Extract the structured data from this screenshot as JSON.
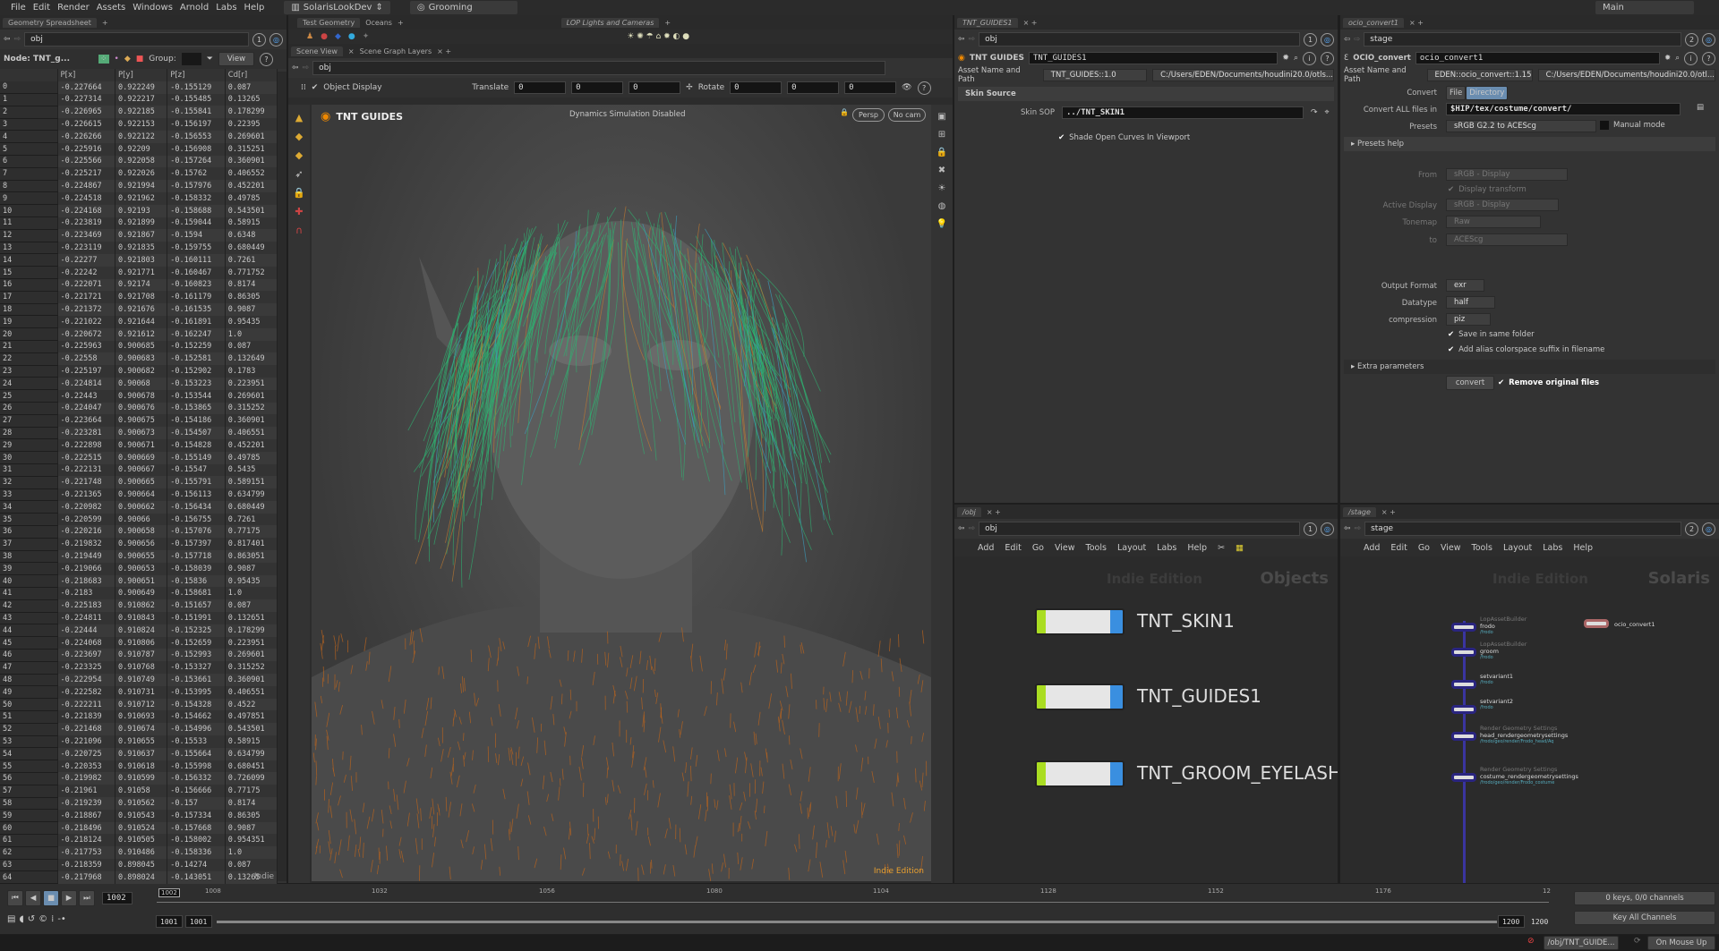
{
  "menu": [
    "File",
    "Edit",
    "Render",
    "Assets",
    "Windows",
    "Arnold",
    "Labs",
    "Help"
  ],
  "desktop": "SolarisLookDev",
  "context": "Grooming",
  "main_desk": "Main",
  "spreadsheet": {
    "tab": "Geometry Spreadsheet",
    "path": "obj",
    "node_label": "Node: TNT_g...",
    "group_label": "Group:",
    "view_label": "View",
    "indie": "Indie",
    "columns": [
      "",
      "P[x]",
      "P[y]",
      "P[z]",
      "Cd[r]"
    ],
    "rows": [
      [
        "0",
        "-0.227664",
        "0.922249",
        "-0.155129",
        "0.087"
      ],
      [
        "1",
        "-0.227314",
        "0.922217",
        "-0.155485",
        "0.13265"
      ],
      [
        "2",
        "-0.226965",
        "0.922185",
        "-0.155841",
        "0.178299"
      ],
      [
        "3",
        "-0.226615",
        "0.922153",
        "-0.156197",
        "0.22395"
      ],
      [
        "4",
        "-0.226266",
        "0.922122",
        "-0.156553",
        "0.269601"
      ],
      [
        "5",
        "-0.225916",
        "0.92209",
        "-0.156908",
        "0.315251"
      ],
      [
        "6",
        "-0.225566",
        "0.922058",
        "-0.157264",
        "0.360901"
      ],
      [
        "7",
        "-0.225217",
        "0.922026",
        "-0.15762",
        "0.406552"
      ],
      [
        "8",
        "-0.224867",
        "0.921994",
        "-0.157976",
        "0.452201"
      ],
      [
        "9",
        "-0.224518",
        "0.921962",
        "-0.158332",
        "0.49785"
      ],
      [
        "10",
        "-0.224168",
        "0.92193",
        "-0.158688",
        "0.543501"
      ],
      [
        "11",
        "-0.223819",
        "0.921899",
        "-0.159044",
        "0.58915"
      ],
      [
        "12",
        "-0.223469",
        "0.921867",
        "-0.1594",
        "0.6348"
      ],
      [
        "13",
        "-0.223119",
        "0.921835",
        "-0.159755",
        "0.680449"
      ],
      [
        "14",
        "-0.22277",
        "0.921803",
        "-0.160111",
        "0.7261"
      ],
      [
        "15",
        "-0.22242",
        "0.921771",
        "-0.160467",
        "0.771752"
      ],
      [
        "16",
        "-0.222071",
        "0.92174",
        "-0.160823",
        "0.8174"
      ],
      [
        "17",
        "-0.221721",
        "0.921708",
        "-0.161179",
        "0.86305"
      ],
      [
        "18",
        "-0.221372",
        "0.921676",
        "-0.161535",
        "0.9087"
      ],
      [
        "19",
        "-0.221022",
        "0.921644",
        "-0.161891",
        "0.95435"
      ],
      [
        "20",
        "-0.220672",
        "0.921612",
        "-0.162247",
        "1.0"
      ],
      [
        "21",
        "-0.225963",
        "0.900685",
        "-0.152259",
        "0.087"
      ],
      [
        "22",
        "-0.22558",
        "0.900683",
        "-0.152581",
        "0.132649"
      ],
      [
        "23",
        "-0.225197",
        "0.900682",
        "-0.152902",
        "0.1783"
      ],
      [
        "24",
        "-0.224814",
        "0.90068",
        "-0.153223",
        "0.223951"
      ],
      [
        "25",
        "-0.22443",
        "0.900678",
        "-0.153544",
        "0.269601"
      ],
      [
        "26",
        "-0.224047",
        "0.900676",
        "-0.153865",
        "0.315252"
      ],
      [
        "27",
        "-0.223664",
        "0.900675",
        "-0.154186",
        "0.360901"
      ],
      [
        "28",
        "-0.223281",
        "0.900673",
        "-0.154507",
        "0.406551"
      ],
      [
        "29",
        "-0.222898",
        "0.900671",
        "-0.154828",
        "0.452201"
      ],
      [
        "30",
        "-0.222515",
        "0.900669",
        "-0.155149",
        "0.49785"
      ],
      [
        "31",
        "-0.222131",
        "0.900667",
        "-0.15547",
        "0.5435"
      ],
      [
        "32",
        "-0.221748",
        "0.900665",
        "-0.155791",
        "0.589151"
      ],
      [
        "33",
        "-0.221365",
        "0.900664",
        "-0.156113",
        "0.634799"
      ],
      [
        "34",
        "-0.220982",
        "0.900662",
        "-0.156434",
        "0.680449"
      ],
      [
        "35",
        "-0.220599",
        "0.90066",
        "-0.156755",
        "0.7261"
      ],
      [
        "36",
        "-0.220216",
        "0.900658",
        "-0.157076",
        "0.77175"
      ],
      [
        "37",
        "-0.219832",
        "0.900656",
        "-0.157397",
        "0.817401"
      ],
      [
        "38",
        "-0.219449",
        "0.900655",
        "-0.157718",
        "0.863051"
      ],
      [
        "39",
        "-0.219066",
        "0.900653",
        "-0.158039",
        "0.9087"
      ],
      [
        "40",
        "-0.218683",
        "0.900651",
        "-0.15836",
        "0.95435"
      ],
      [
        "41",
        "-0.2183",
        "0.900649",
        "-0.158681",
        "1.0"
      ],
      [
        "42",
        "-0.225183",
        "0.910862",
        "-0.151657",
        "0.087"
      ],
      [
        "43",
        "-0.224811",
        "0.910843",
        "-0.151991",
        "0.132651"
      ],
      [
        "44",
        "-0.22444",
        "0.910824",
        "-0.152325",
        "0.178299"
      ],
      [
        "45",
        "-0.224068",
        "0.910806",
        "-0.152659",
        "0.223951"
      ],
      [
        "46",
        "-0.223697",
        "0.910787",
        "-0.152993",
        "0.269601"
      ],
      [
        "47",
        "-0.223325",
        "0.910768",
        "-0.153327",
        "0.315252"
      ],
      [
        "48",
        "-0.222954",
        "0.910749",
        "-0.153661",
        "0.360901"
      ],
      [
        "49",
        "-0.222582",
        "0.910731",
        "-0.153995",
        "0.406551"
      ],
      [
        "50",
        "-0.222211",
        "0.910712",
        "-0.154328",
        "0.4522"
      ],
      [
        "51",
        "-0.221839",
        "0.910693",
        "-0.154662",
        "0.497851"
      ],
      [
        "52",
        "-0.221468",
        "0.910674",
        "-0.154996",
        "0.543501"
      ],
      [
        "53",
        "-0.221096",
        "0.910655",
        "-0.15533",
        "0.58915"
      ],
      [
        "54",
        "-0.220725",
        "0.910637",
        "-0.155664",
        "0.634799"
      ],
      [
        "55",
        "-0.220353",
        "0.910618",
        "-0.155998",
        "0.680451"
      ],
      [
        "56",
        "-0.219982",
        "0.910599",
        "-0.156332",
        "0.726099"
      ],
      [
        "57",
        "-0.21961",
        "0.91058",
        "-0.156666",
        "0.77175"
      ],
      [
        "58",
        "-0.219239",
        "0.910562",
        "-0.157",
        "0.8174"
      ],
      [
        "59",
        "-0.218867",
        "0.910543",
        "-0.157334",
        "0.86305"
      ],
      [
        "60",
        "-0.218496",
        "0.910524",
        "-0.157668",
        "0.9087"
      ],
      [
        "61",
        "-0.218124",
        "0.910505",
        "-0.158002",
        "0.954351"
      ],
      [
        "62",
        "-0.217753",
        "0.910486",
        "-0.158336",
        "1.0"
      ],
      [
        "63",
        "-0.218359",
        "0.898045",
        "-0.14274",
        "0.087"
      ],
      [
        "64",
        "-0.217968",
        "0.898024",
        "-0.143051",
        "0.13265"
      ]
    ]
  },
  "shelf": {
    "tabs": [
      "Test Geometry",
      "Oceans"
    ],
    "tabs2": [
      "LOP Lights and Cameras"
    ]
  },
  "viewer": {
    "tabs": [
      "Scene View",
      "Scene Graph Layers"
    ],
    "path": "obj",
    "object_display": "Object Display",
    "translate_label": "Translate",
    "translate": [
      "0",
      "0",
      "0"
    ],
    "rotate_label": "Rotate",
    "rotate": [
      "0",
      "0",
      "0"
    ],
    "title": "TNT GUIDES",
    "status": "Dynamics Simulation Disabled",
    "persp": "Persp",
    "cam": "No cam",
    "indie": "Indie Edition"
  },
  "params1": {
    "tab": "TNT_GUIDES1",
    "path": "obj",
    "type": "TNT GUIDES",
    "name": "TNT_GUIDES1",
    "asset_label": "Asset Name and Path",
    "asset": "TNT_GUIDES::1.0",
    "asset_path": "C:/Users/EDEN/Documents/houdini20.0/otls...",
    "section": "Skin Source",
    "skin_label": "Skin SOP",
    "skin": "../TNT_SKIN1",
    "shade": "Shade Open Curves In Viewport"
  },
  "params2": {
    "tab": "ocio_convert1",
    "path": "stage",
    "type": "OCIO_convert",
    "name": "ocio_convert1",
    "asset_label": "Asset Name and Path",
    "asset": "EDEN::ocio_convert::1.15",
    "asset_path": "C:/Users/EDEN/Documents/houdini20.0/otl...",
    "convert_label": "Convert",
    "convert_file": "File",
    "convert_dir": "Directory",
    "all_label": "Convert ALL files in",
    "all": "$HIP/tex/costume/convert/",
    "presets_label": "Presets",
    "presets": "sRGB G2.2 to ACEScg",
    "manual": "Manual mode",
    "presets_help": "Presets help",
    "from_label": "From",
    "from": "sRGB - Display",
    "display_transform": "Display transform",
    "active_label": "Active Display",
    "active": "sRGB - Display",
    "tonemap_label": "Tonemap",
    "tonemap": "Raw",
    "to_label": "to",
    "to": "ACEScg",
    "format_label": "Output Format",
    "format": "exr",
    "datatype_label": "Datatype",
    "datatype": "half",
    "comp_label": "compression",
    "comp": "piz",
    "same_folder": "Save in same folder",
    "alias": "Add alias colorspace suffix in filename",
    "extra": "Extra parameters",
    "convert_btn": "convert",
    "remove": "Remove original files"
  },
  "net_menu": [
    "Add",
    "Edit",
    "Go",
    "View",
    "Tools",
    "Layout",
    "Labs",
    "Help"
  ],
  "net_obj": {
    "tab": "/obj",
    "path": "obj",
    "watermark": "Indie Edition",
    "context": "Objects",
    "nodes": [
      "TNT_SKIN1",
      "TNT_GUIDES1",
      "TNT_GROOM_EYELASHE"
    ]
  },
  "net_stage": {
    "tab": "/stage",
    "path": "stage",
    "watermark": "Indie Edition",
    "context": "Solaris",
    "nodes": [
      {
        "type": "LopAssetBuilder",
        "name": "frodo",
        "sub": "/frodo"
      },
      {
        "type": "LopAssetBuilder",
        "name": "groom",
        "sub": "/frodo"
      },
      {
        "type": "",
        "name": "setvariant1",
        "sub": "/frodo"
      },
      {
        "type": "",
        "name": "setvariant2",
        "sub": "/frodo"
      },
      {
        "type": "Render Geometry Settings",
        "name": "head_rendergeometrysettings",
        "sub": "/frodo/geo/render/Frodo_head/Aq"
      },
      {
        "type": "Render Geometry Settings",
        "name": "costume_rendergeometrysettings",
        "sub": "/frodo/geo/render/Frodo_costume"
      }
    ],
    "ocio": "ocio_convert1"
  },
  "timeline": {
    "frame": "1002",
    "marker": "1002",
    "ticks": [
      "1008",
      "1032",
      "1056",
      "1080",
      "1104",
      "1128",
      "1152",
      "1176",
      "12"
    ],
    "start": "1001",
    "start2": "1001",
    "end": "1200",
    "end2": "1200",
    "keys": "0 keys, 0/0 channels",
    "key_all": "Key All Channels"
  },
  "status": {
    "path": "/obj/TNT_GUIDE...",
    "update": "On Mouse Up"
  }
}
